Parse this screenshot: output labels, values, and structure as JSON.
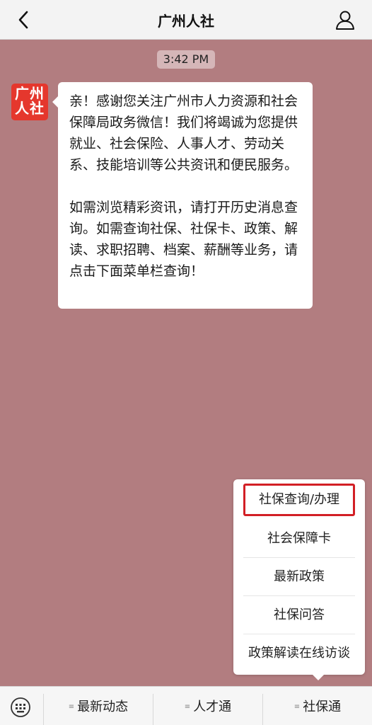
{
  "header": {
    "title": "广州人社"
  },
  "chat": {
    "time": "3:42 PM",
    "avatar_line1": "广州",
    "avatar_line2": "人社",
    "message_p1": "亲！感谢您关注广州市人力资源和社会保障局政务微信！我们将竭诚为您提供就业、社会保险、人事人才、劳动关系、技能培训等公共资讯和便民服务。",
    "message_p2": "如需浏览精彩资讯，请打开历史消息查询。如需查询社保、社保卡、政策、解读、求职招聘、档案、薪酬等业务，请点击下面菜单栏查询！"
  },
  "popup_menu": {
    "items": [
      "社保查询/办理",
      "社会保障卡",
      "最新政策",
      "社保问答",
      "政策解读在线访谈"
    ]
  },
  "bottom_menu": {
    "tabs": [
      "最新动态",
      "人才通",
      "社保通"
    ]
  },
  "colors": {
    "chat_background": "#b27d80",
    "highlight": "#d21f25",
    "avatar": "#e5372d"
  }
}
